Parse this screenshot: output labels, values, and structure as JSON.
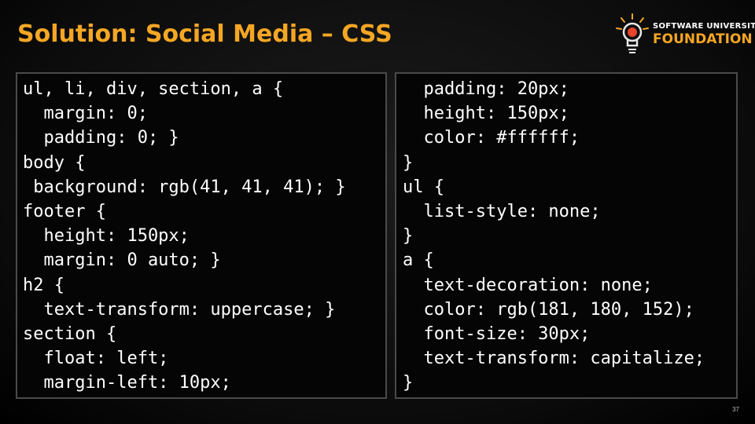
{
  "slide": {
    "title": "Solution: Social Media – CSS",
    "page_number": "37"
  },
  "logo": {
    "top_text": "SOFTWARE UNIVERSITY",
    "bottom_text": "FOUNDATION",
    "icon": "lightbulb-icon",
    "accent_color": "#f5a623"
  },
  "code_left": [
    "ul, li, div, section, a {",
    "  margin: 0;",
    "  padding: 0; }",
    "body {",
    " background: rgb(41, 41, 41); }",
    "footer {",
    "  height: 150px;",
    "  margin: 0 auto; }",
    "h2 {",
    "  text-transform: uppercase; }",
    "section {",
    "  float: left;",
    "  margin-left: 10px;"
  ],
  "code_right": [
    "  padding: 20px;",
    "  height: 150px;",
    "  color: #ffffff;",
    "}",
    "ul {",
    "  list-style: none;",
    "}",
    "a {",
    "  text-decoration: none;",
    "  color: rgb(181, 180, 152);",
    "  font-size: 30px;",
    "  text-transform: capitalize;",
    "}"
  ]
}
